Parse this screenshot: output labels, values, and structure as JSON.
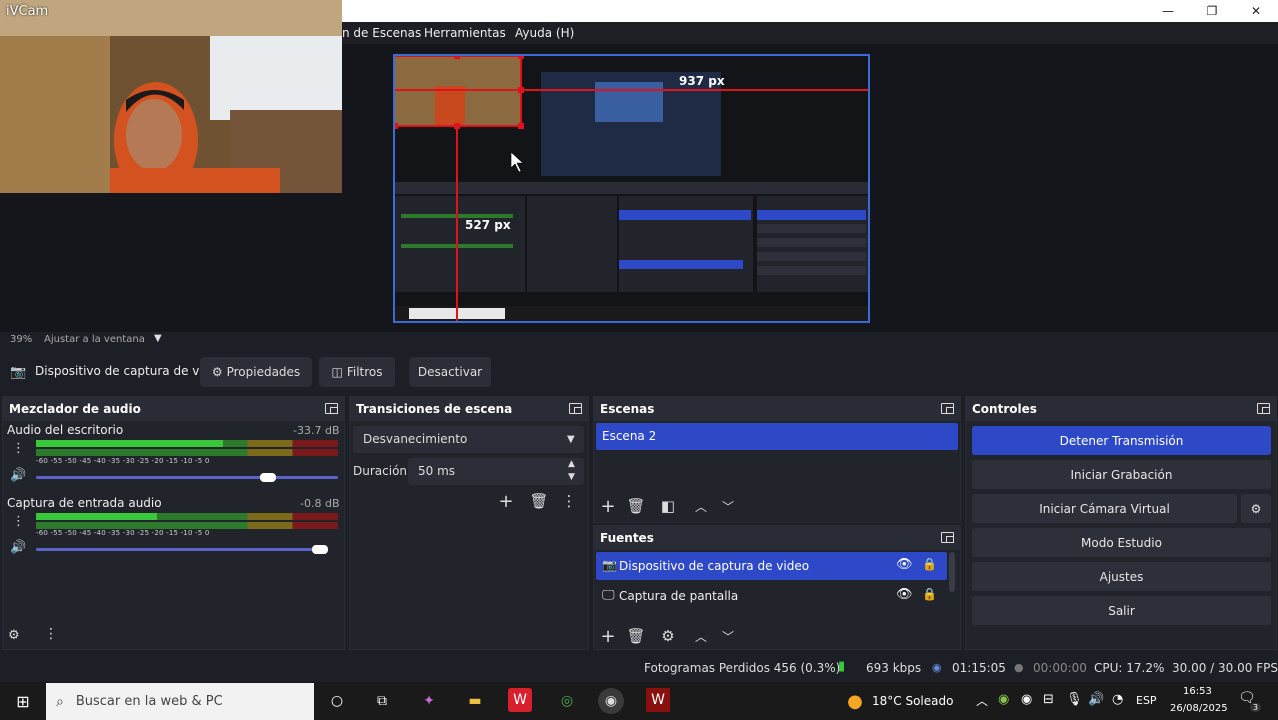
{
  "window": {
    "minimize": "—",
    "maximize": "❐",
    "close": "✕"
  },
  "menu": {
    "scenes_partial": "n de Escenas",
    "tools": "Herramientas",
    "help": "Ayuda (H)"
  },
  "webcam": {
    "label": "iVCam"
  },
  "preview": {
    "measure_width": "937 px",
    "measure_height": "527 px"
  },
  "zoom": {
    "percent": "39%",
    "fit_label": "Ajustar a la ventana"
  },
  "source_toolbar": {
    "source_name": "Dispositivo de captura de v",
    "properties": "Propiedades",
    "filters": "Filtros",
    "deactivate": "Desactivar"
  },
  "mixer": {
    "title": "Mezclador de audio",
    "channels": [
      {
        "name": "Audio del escritorio",
        "db": "-33.7 dB",
        "level": 0.62,
        "volume": 0.8
      },
      {
        "name": "Captura de entrada audio",
        "db": "-0.8 dB",
        "level": 0.4,
        "volume": 0.98
      }
    ],
    "scale": "-60  -55  -50  -45  -40  -35  -30  -25  -20  -15  -10  -5   0"
  },
  "transitions": {
    "title": "Transiciones de escena",
    "selected": "Desvanecimiento",
    "duration_label": "Duración",
    "duration_value": "50 ms"
  },
  "scenes": {
    "title": "Escenas",
    "items": [
      "Escena 2"
    ]
  },
  "sources": {
    "title": "Fuentes",
    "items": [
      "Dispositivo de captura de video",
      "Captura de pantalla"
    ]
  },
  "controls": {
    "title": "Controles",
    "stop_stream": "Detener Transmisión",
    "start_record": "Iniciar Grabación",
    "virtual_cam": "Iniciar Cámara Virtual",
    "studio_mode": "Modo Estudio",
    "settings": "Ajustes",
    "exit": "Salir"
  },
  "status": {
    "dropped": "Fotogramas Perdidos 456 (0.3%)",
    "bitrate": "693 kbps",
    "stream_time": "01:15:05",
    "rec_time": "00:00:00",
    "cpu": "CPU: 17.2%",
    "fps": "30.00 / 30.00 FPS"
  },
  "taskbar": {
    "search_placeholder": "Buscar en la web & PC",
    "weather": "18°C  Soleado",
    "lang": "ESP",
    "time": "16:53",
    "date": "26/08/2025",
    "notif_count": "3"
  },
  "colors": {
    "accent": "#2e49c7",
    "bg": "#1d1f26",
    "panel": "#22242c",
    "guide": "#e0121a"
  }
}
